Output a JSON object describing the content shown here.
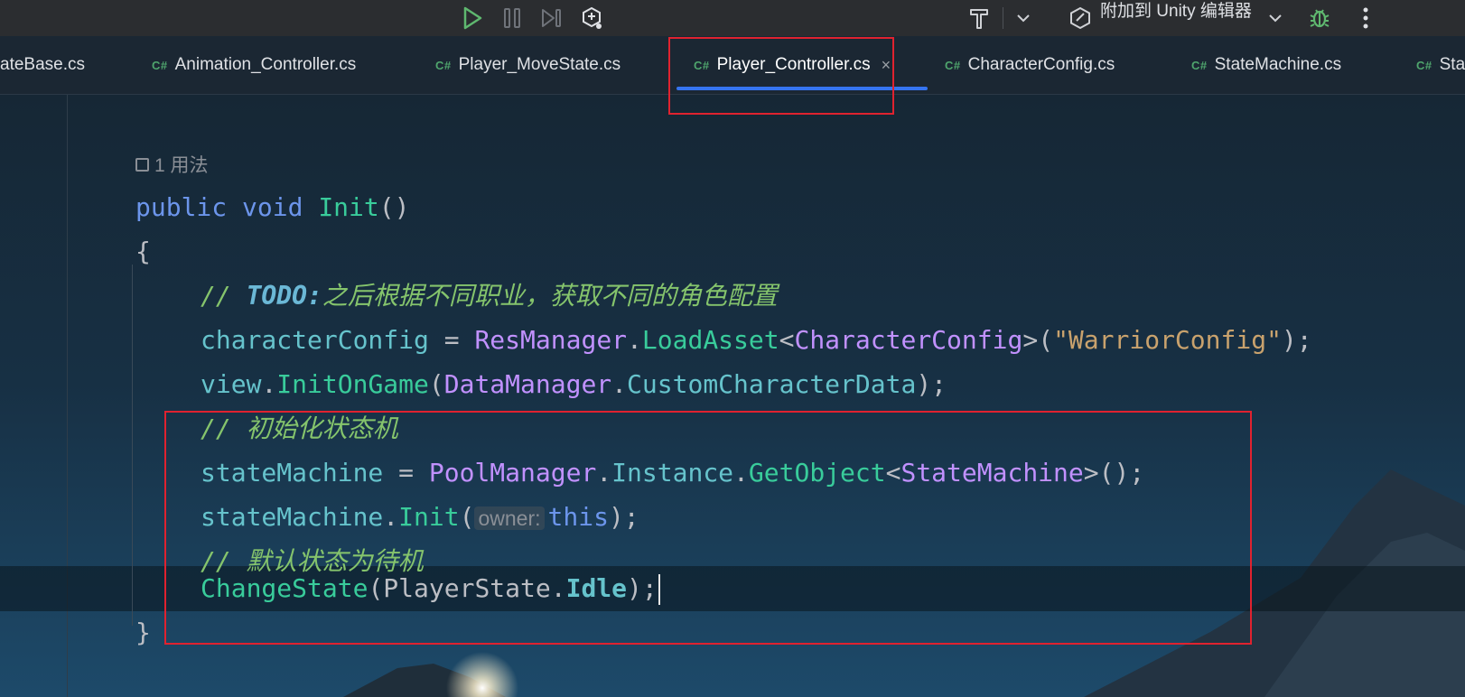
{
  "toolbar": {
    "attach_label": "附加到 Unity 编辑器",
    "icons": [
      "run-icon",
      "pause-icon",
      "step-icon",
      "unity-debug-icon",
      "hammer-icon",
      "chevron-down-icon",
      "unity-attach-icon",
      "chevron-down-icon",
      "bug-icon",
      "more-icon"
    ]
  },
  "tabs": [
    {
      "name": "ateBase.cs",
      "badge": ""
    },
    {
      "name": "Animation_Controller.cs",
      "badge": "C#"
    },
    {
      "name": "Player_MoveState.cs",
      "badge": "C#"
    },
    {
      "name": "Player_Controller.cs",
      "badge": "C#",
      "active": true,
      "close": "×"
    },
    {
      "name": "CharacterConfig.cs",
      "badge": "C#"
    },
    {
      "name": "StateMachine.cs",
      "badge": "C#"
    },
    {
      "name": "Sta",
      "badge": "C#"
    }
  ],
  "editor": {
    "usage_hint": "1 用法",
    "code": {
      "l1": {
        "kw1": "public",
        "kw2": "void",
        "fn": "Init",
        "p": "()"
      },
      "l2": "{",
      "l3": {
        "slashes": "// ",
        "todo": "TODO:",
        "text": "之后根据不同职业，获取不同的角色配置"
      },
      "l4": {
        "var": "characterConfig",
        "op": " = ",
        "type1": "ResManager",
        "dot": ".",
        "fn": "LoadAsset",
        "lt": "<",
        "type2": "CharacterConfig",
        "gt": ">(",
        "str": "\"WarriorConfig\"",
        "end": ");"
      },
      "l5": {
        "var": "view",
        "dot": ".",
        "fn": "InitOnGame",
        "lp": "(",
        "type": "DataManager",
        "dot2": ".",
        "field": "CustomCharacterData",
        "end": ");"
      },
      "l6": {
        "slashes": "// ",
        "text": "初始化状态机"
      },
      "l7": {
        "var": "stateMachine",
        "op": " = ",
        "type1": "PoolManager",
        "dot": ".",
        "field": "Instance",
        "dot2": ".",
        "fn": "GetObject",
        "lt": "<",
        "type2": "StateMachine",
        "gt": ">();"
      },
      "l8": {
        "var": "stateMachine",
        "dot": ".",
        "fn": "Init",
        "lp": "(",
        "hint": "owner:",
        "kw": "this",
        "end": ");"
      },
      "l9": {
        "slashes": "// ",
        "text": "默认状态为待机"
      },
      "l10": {
        "fn": "ChangeState",
        "lp": "(",
        "type": "PlayerState",
        "dot": ".",
        "enum": "Idle",
        "end": ");"
      },
      "l11": "}"
    }
  },
  "colors": {
    "keyword": "#6c95eb",
    "method": "#39cc9b",
    "type": "#c191ff",
    "field": "#66c3cc",
    "string": "#c9a26d",
    "comment": "#85c46c",
    "annotation": "#e0222f",
    "tab_underline": "#3574f0"
  }
}
